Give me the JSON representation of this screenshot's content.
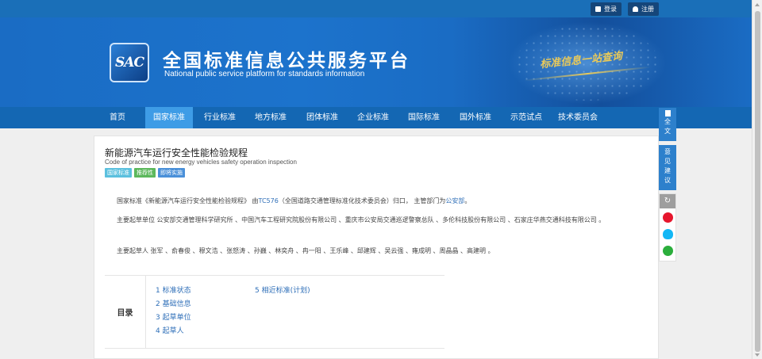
{
  "topbar": {
    "login_label": "登录",
    "register_label": "注册"
  },
  "header": {
    "logo_text": "SAC",
    "title_cn": "全国标准信息公共服务平台",
    "title_en": "National public service platform  for standards information",
    "slogan": "标准信息一站查询"
  },
  "nav": {
    "items": [
      {
        "label": "首页"
      },
      {
        "label": "国家标准"
      },
      {
        "label": "行业标准"
      },
      {
        "label": "地方标准"
      },
      {
        "label": "团体标准"
      },
      {
        "label": "企业标准"
      },
      {
        "label": "国际标准"
      },
      {
        "label": "国外标准"
      },
      {
        "label": "示范试点"
      },
      {
        "label": "技术委员会"
      }
    ],
    "active": "国家标准"
  },
  "standard": {
    "title": "新能源汽车运行安全性能检验规程",
    "title_en": "Code of practice for new energy vehicles safety operation inspection",
    "badges": [
      {
        "label": "国家标准",
        "color": "#5bc0de"
      },
      {
        "label": "推荐性",
        "color": "#5cb85c"
      },
      {
        "label": "即将实施",
        "color": "#4a90d9"
      }
    ],
    "intro_prefix": "国家标准《新能源汽车运行安全性能检验规程》 由",
    "tc_link": "TC576",
    "intro_mid": "（全国道路交通管理标准化技术委员会）归口， 主管部门为",
    "dept_link": "公安部",
    "intro_suffix": "。",
    "drafting_units": "主要起草单位 公安部交通管理科学研究所 、中国汽车工程研究院股份有限公司 、重庆市公安局交通巡逻警察总队 、多伦科技股份有限公司 、石家庄华燕交通科技有限公司 。",
    "drafters": "主要起草人 张军 、俞春俊 、穆文浩 、张怒涛 、孙巍 、林奕舟 、冉一阳 、王乐峰 、邱建辉 、吴云强 、雍成明 、周晶晶 、高建明 。"
  },
  "toc": {
    "heading": "目录",
    "items": [
      {
        "label": "1  标准状态"
      },
      {
        "label": "2  基础信息"
      },
      {
        "label": "3  起草单位"
      },
      {
        "label": "4  起草人"
      },
      {
        "label": "5  相近标准(计划)"
      }
    ]
  },
  "side": {
    "fulltext": "全文",
    "feedback": "意见建议"
  },
  "colors": {
    "nav_bg": "#1467b3",
    "nav_active": "#3e9ce6",
    "link": "#2f6fb8",
    "side_bg": "#2d80cc"
  }
}
